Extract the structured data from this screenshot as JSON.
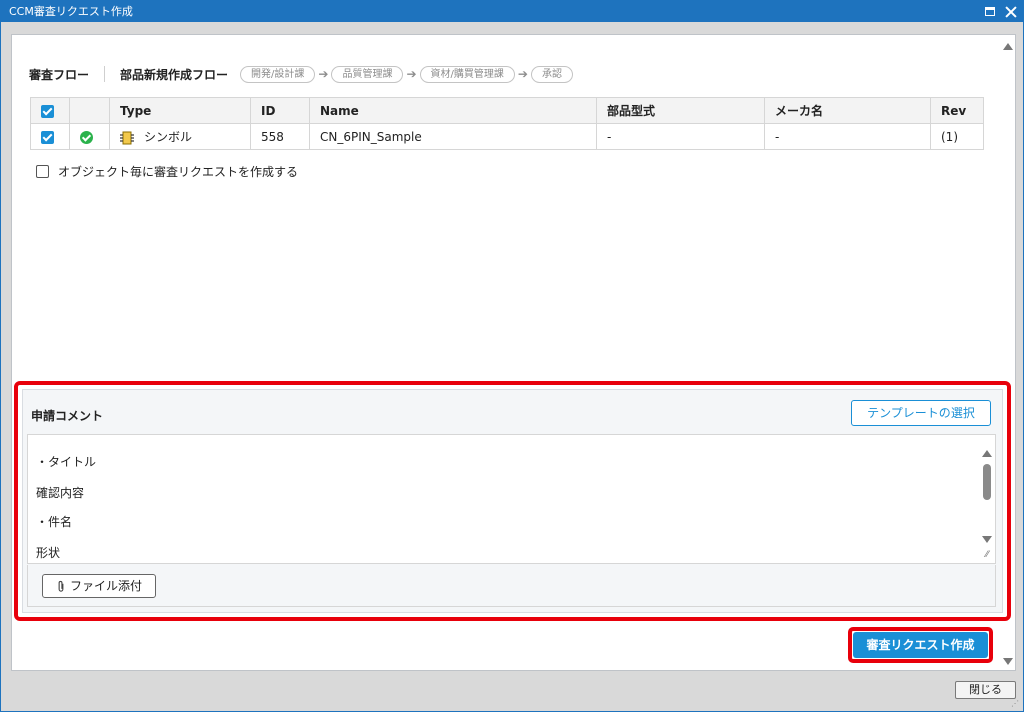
{
  "window": {
    "title": "CCM審査リクエスト作成"
  },
  "flow": {
    "title": "審査フロー",
    "name": "部品新規作成フロー",
    "steps": [
      "開発/設計課",
      "品質管理課",
      "資材/購買管理課",
      "承認"
    ],
    "arrow": "➔"
  },
  "table": {
    "headers": [
      "",
      "",
      "Type",
      "ID",
      "Name",
      "部品型式",
      "メーカ名",
      "Rev"
    ],
    "rows": [
      {
        "type": "シンボル",
        "id": "558",
        "name": "CN_6PIN_Sample",
        "model": "-",
        "maker": "-",
        "rev": "(1)"
      }
    ]
  },
  "options": {
    "per_object_label": "オブジェクト毎に審査リクエストを作成する"
  },
  "comment": {
    "label": "申請コメント",
    "template_button": "テンプレートの選択",
    "lines": [
      "・タイトル",
      "確認内容",
      "・件名",
      "形状"
    ],
    "attach_button": "ファイル添付"
  },
  "actions": {
    "submit": "審査リクエスト作成",
    "close": "閉じる"
  },
  "colors": {
    "accent": "#1a8fd6",
    "highlight": "#e8000b",
    "titlebar": "#1e73be",
    "ok": "#2bb24c"
  }
}
